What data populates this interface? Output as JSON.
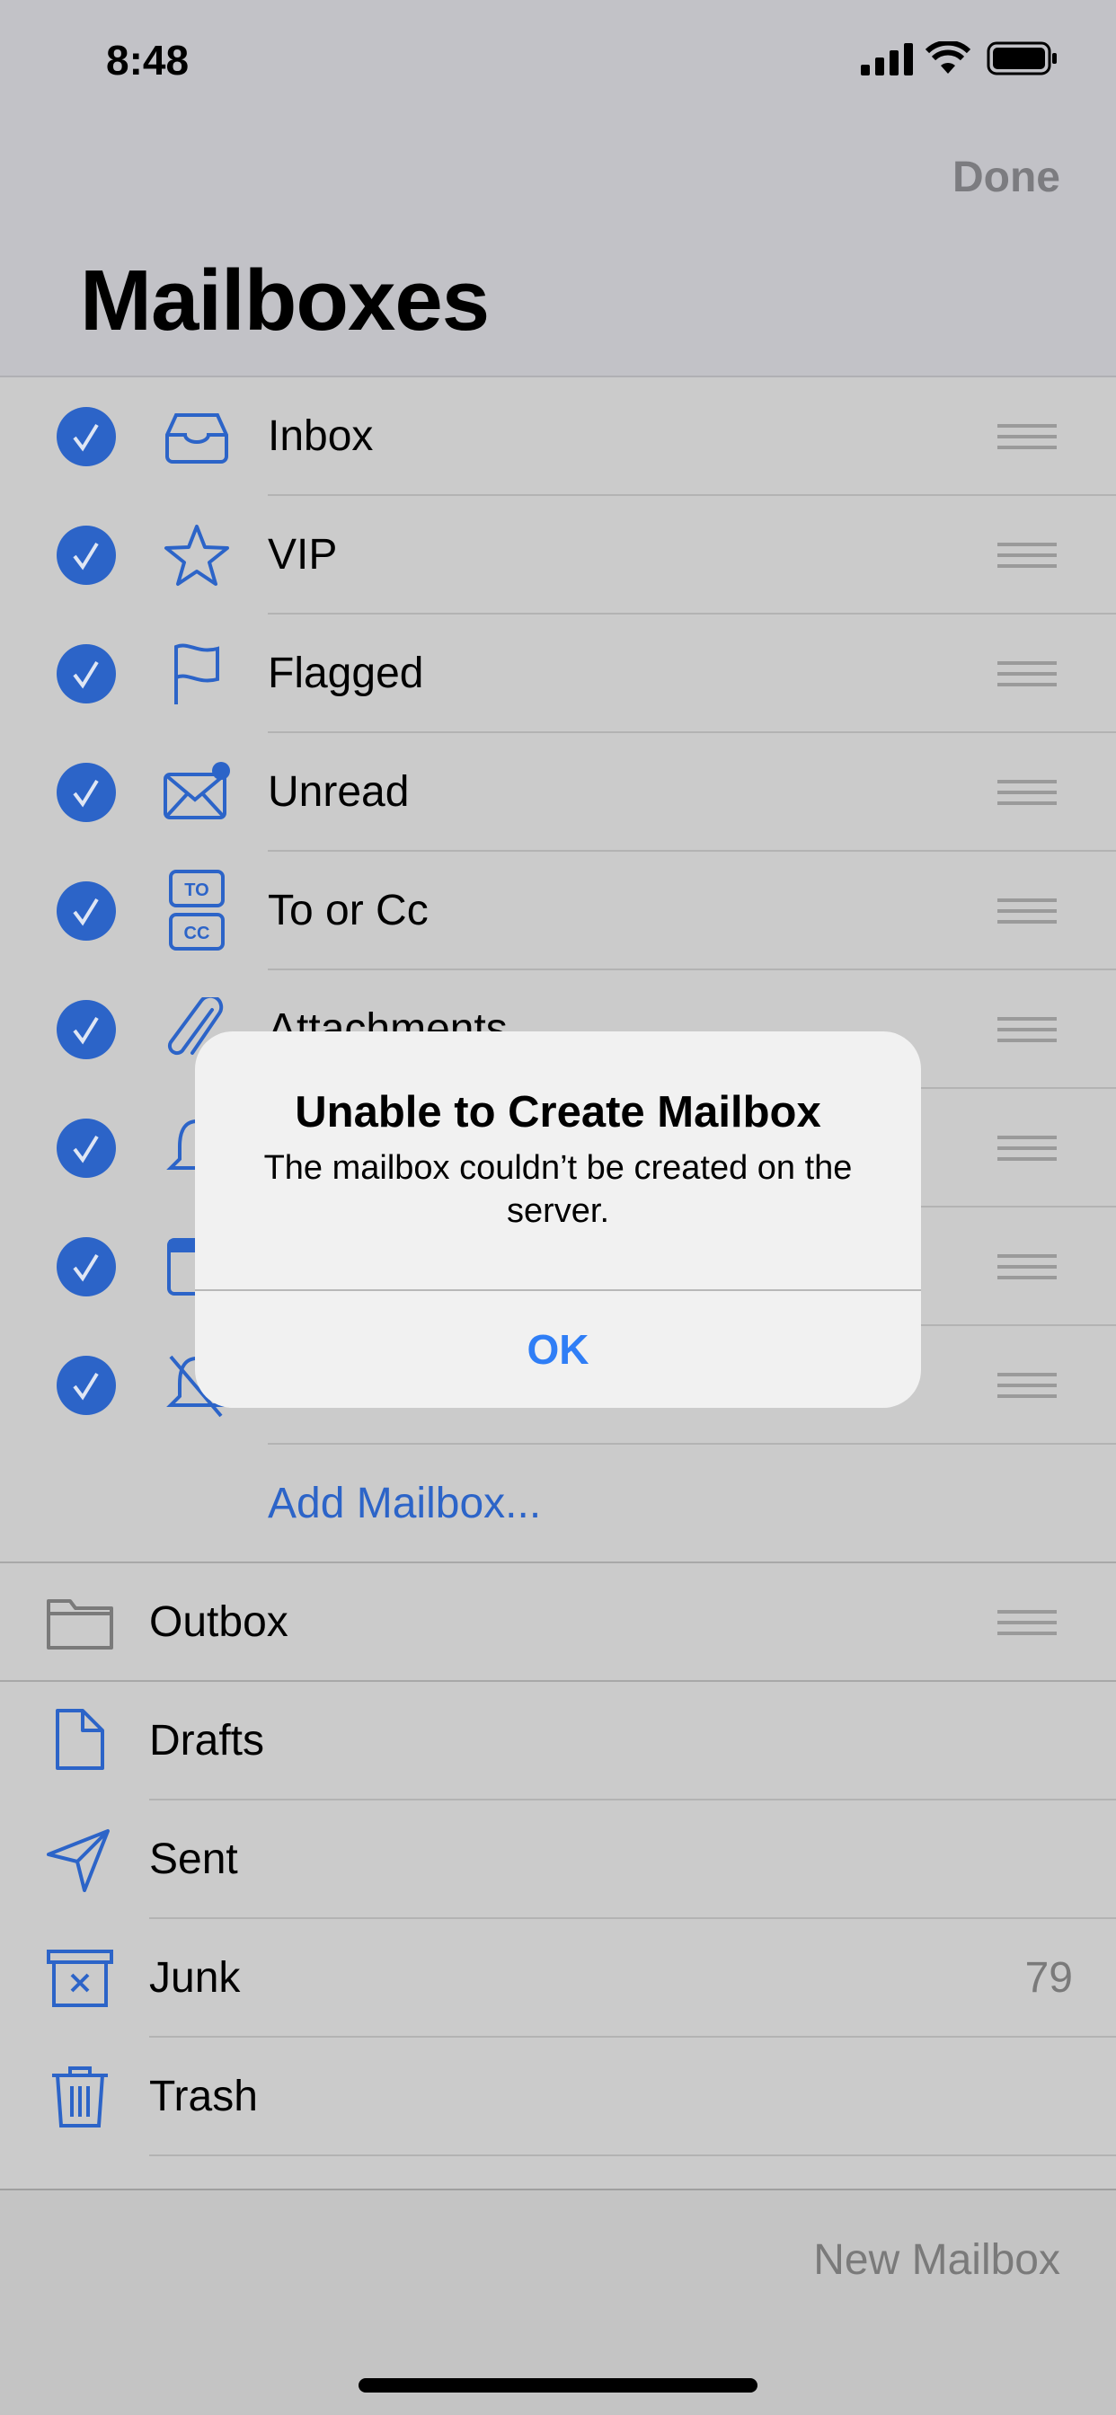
{
  "status_bar": {
    "time": "8:48"
  },
  "header": {
    "done_label": "Done",
    "title": "Mailboxes"
  },
  "colors": {
    "accent": "#2c64c8",
    "alert_button": "#2f7ef6"
  },
  "mailboxes": [
    {
      "label": "Inbox",
      "icon": "inbox-icon",
      "checked": true
    },
    {
      "label": "VIP",
      "icon": "star-icon",
      "checked": true
    },
    {
      "label": "Flagged",
      "icon": "flag-icon",
      "checked": true
    },
    {
      "label": "Unread",
      "icon": "envelope-unread-icon",
      "checked": true
    },
    {
      "label": "To or Cc",
      "icon": "to-cc-icon",
      "checked": true
    },
    {
      "label": "Attachments",
      "icon": "paperclip-icon",
      "checked": true
    },
    {
      "label": "",
      "icon": "bell-icon",
      "checked": true
    },
    {
      "label": "",
      "icon": "calendar-icon",
      "checked": true
    },
    {
      "label": "",
      "icon": "bell-slash-icon",
      "checked": true
    }
  ],
  "add_mailbox_label": "Add Mailbox...",
  "accounts": [
    {
      "label": "Outbox",
      "icon": "folder-icon"
    },
    {
      "label": "Drafts",
      "icon": "document-icon"
    },
    {
      "label": "Sent",
      "icon": "paperplane-icon"
    },
    {
      "label": "Junk",
      "icon": "junk-icon",
      "count": "79"
    },
    {
      "label": "Trash",
      "icon": "trash-icon"
    }
  ],
  "toolbar": {
    "new_mailbox_label": "New Mailbox"
  },
  "alert": {
    "title": "Unable to Create Mailbox",
    "message": "The mailbox couldn’t be created on the server.",
    "ok_label": "OK"
  }
}
